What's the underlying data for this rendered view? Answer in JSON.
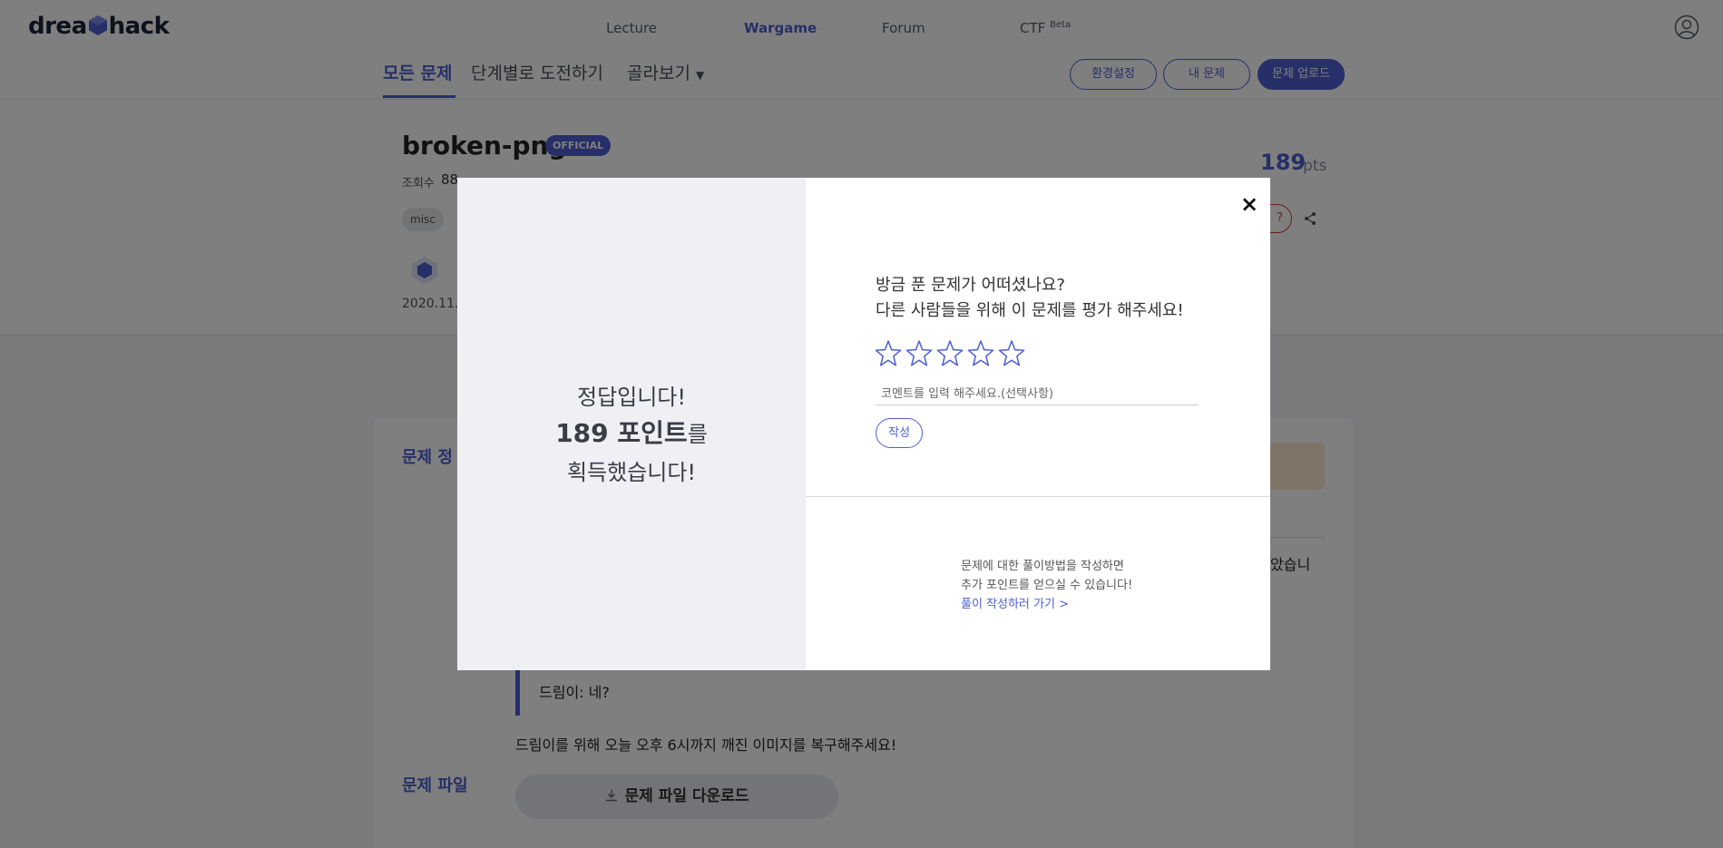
{
  "brand": {
    "logo_text_left": "drea",
    "logo_text_right": "hack"
  },
  "nav": {
    "items": [
      {
        "label": "Lecture"
      },
      {
        "label": "Wargame"
      },
      {
        "label": "Forum"
      },
      {
        "label": "CTF",
        "badge": "Beta"
      }
    ],
    "active": "Wargame"
  },
  "subnav": {
    "tabs": [
      {
        "label": "모든 문제"
      },
      {
        "label": "단계별로 도전하기"
      },
      {
        "label": "골라보기"
      }
    ],
    "buttons": [
      {
        "label": "환경설정"
      },
      {
        "label": "내 문제"
      },
      {
        "label": "문제 업로드"
      }
    ]
  },
  "challenge": {
    "title": "broken-png",
    "official_badge": "OFFICIAL",
    "views_label": "조회수",
    "views_value": "88",
    "tag": "misc",
    "date": "2020.11.",
    "points": "189",
    "points_unit": "pts",
    "partial_badge": "?"
  },
  "content": {
    "info_label": "문제 정",
    "file_label": "문제 파일",
    "para_tail": "았습니",
    "quote": "드림이: 네?",
    "story": "드림이를 위해 오늘 오후 6시까지 깨진 이미지를 복구해주세요!",
    "download_label": "문제 파일 다운로드"
  },
  "modal": {
    "result_line1": "정답입니다!",
    "result_points": "189 포인트",
    "result_suffix": "를",
    "result_line3": "획득했습니다!",
    "question_line1": "방금 푼 문제가 어떠셨나요?",
    "question_line2": "다른 사람들을 위해 이 문제를 평가 해주세요!",
    "rating": 0,
    "rating_max": 5,
    "comment_placeholder": "코멘트를 입력 해주세요.(선택사항)",
    "comment_value": "",
    "submit_label": "작성",
    "writeup_line1": "문제에 대한 풀이방법을 작성하면",
    "writeup_line2": "추가 포인트를 얻으실 수 있습니다!",
    "writeup_link": "풀이 작성하러 가기 >",
    "close_symbol": "×"
  },
  "colors": {
    "accent": "#4d5fd1",
    "overlay": "rgba(0,0,0,0.5)",
    "left_panel": "#efeff4",
    "danger": "#d43b3b"
  }
}
